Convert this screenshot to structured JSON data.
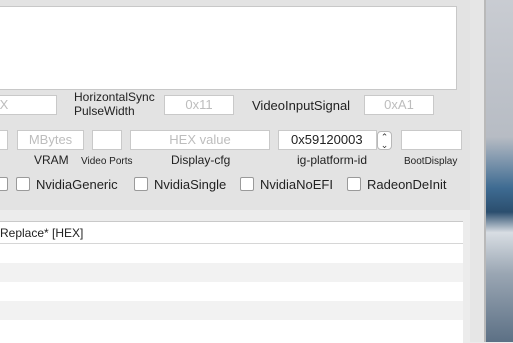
{
  "row1": {
    "field_left_placeholder": "XX",
    "hsync_label_line1": "HorizontalSync",
    "hsync_label_line2": "PulseWidth",
    "hsync_placeholder": "0x11",
    "video_input_label": "VideoInputSignal",
    "video_input_placeholder": "0xA1"
  },
  "row2": {
    "vram_placeholder": "MBytes",
    "vram_label": "VRAM",
    "video_ports_label": "Video Ports",
    "display_cfg_placeholder": "HEX value",
    "display_cfg_label": "Display-cfg",
    "ig_platform_value": "0x59120003",
    "ig_platform_label": "ig-platform-id",
    "boot_display_label": "BootDisplay"
  },
  "checkboxes": [
    "NvidiaGeneric",
    "NvidiaSingle",
    "NvidiaNoEFI",
    "RadeonDeInit"
  ],
  "table": {
    "header": "Replace* [HEX]"
  }
}
